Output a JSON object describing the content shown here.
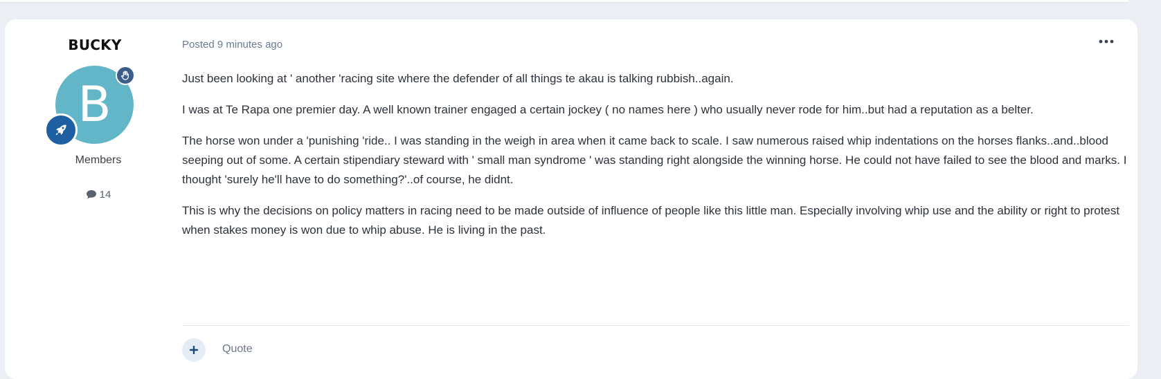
{
  "post": {
    "author": {
      "name": "BUCKY",
      "avatar_letter": "B",
      "avatar_color": "#63b6c7",
      "badge_top_icon": "hand-icon",
      "badge_bottom_icon": "rocket-icon",
      "group": "Members",
      "post_count": "14",
      "post_count_icon": "comment-icon"
    },
    "meta": {
      "posted_label": "Posted 9 minutes ago"
    },
    "menu_icon": "ellipsis-icon",
    "body": [
      "Just been looking at ' another 'racing site where the defender of all things te akau is talking rubbish..again.",
      "I was at Te Rapa one premier day. A well known trainer engaged a certain jockey ( no names here ) who usually never rode for him..but had a reputation as a belter.",
      "The horse won under a 'punishing 'ride.. I was standing in the weigh in area when it came back to scale. I saw numerous raised whip indentations on the horses flanks..and..blood seeping out of some. A certain stipendiary steward with ' small man syndrome ' was standing right alongside the winning horse. He could not have failed to see the blood and marks. I thought 'surely he'll have to do something?'..of course, he didnt.",
      "This is why the decisions on policy matters in racing need to be made outside of influence of people like this little man. Especially involving whip use and the ability or right to protest when stakes money is won due to whip abuse. He is living in the past."
    ],
    "actions": {
      "quote_icon": "plus-icon",
      "quote_label": "Quote"
    }
  },
  "colors": {
    "page_bg": "#ebeef2",
    "card_bg": "#ffffff",
    "accent": "#1d5fa0",
    "meta_text": "#6b7a90"
  }
}
